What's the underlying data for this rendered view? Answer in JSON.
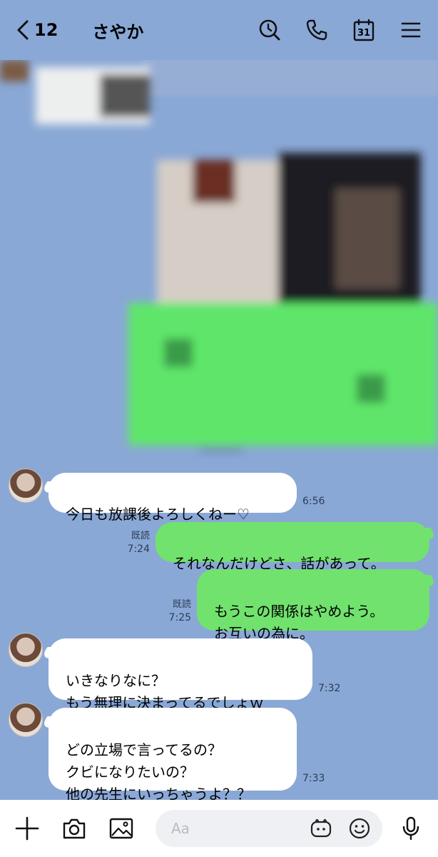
{
  "header": {
    "back_count": "12",
    "contact_name": "さやか",
    "calendar_day": "31"
  },
  "messages": [
    {
      "side": "left",
      "text": "今日も放課後よろしくねー♡",
      "time": "6:56"
    },
    {
      "side": "right",
      "text": "それなんだけどさ、話があって。",
      "read": "既読",
      "time": "7:24"
    },
    {
      "side": "right",
      "text": "もうこの関係はやめよう。\nお互いの為に。",
      "read": "既読",
      "time": "7:25"
    },
    {
      "side": "left",
      "text": "いきなりなに？\nもう無理に決まってるでしょｗ",
      "time": "7:32"
    },
    {
      "side": "left",
      "text": "どの立場で言ってるの？\nクビになりたいの？\n他の先生にいっちゃうよ？？",
      "time": "7:33"
    }
  ],
  "composer": {
    "placeholder": "Aa"
  },
  "icons": {
    "back": "chevron-left-icon",
    "search": "search-icon",
    "call": "phone-icon",
    "calendar": "calendar-icon",
    "menu": "menu-icon",
    "add": "plus-icon",
    "camera": "camera-icon",
    "image": "image-icon",
    "sticker": "sticker-icon",
    "emoji": "emoji-icon",
    "mic": "mic-icon"
  },
  "colors": {
    "background": "#8aa8d6",
    "sent_bubble": "#71e26d",
    "received_bubble": "#ffffff"
  }
}
